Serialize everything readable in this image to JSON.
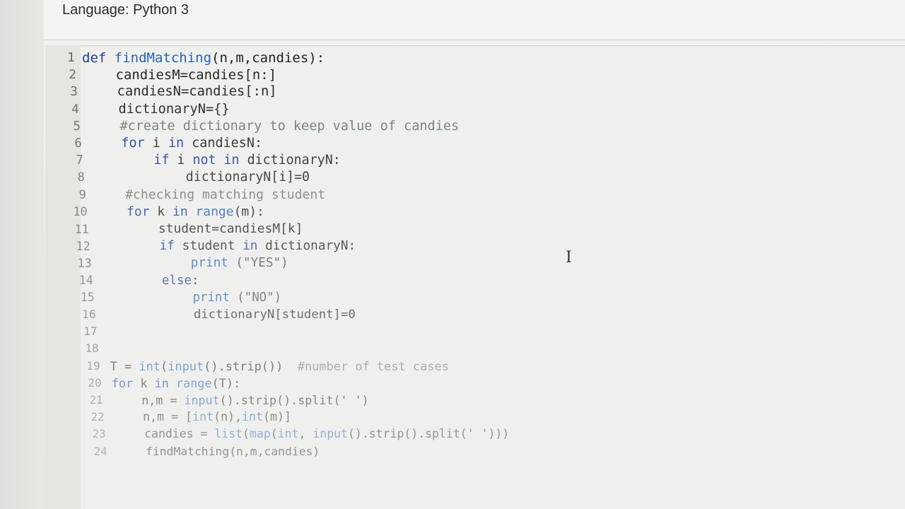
{
  "header": {
    "language_label": "Language: Python 3"
  },
  "editor": {
    "lines": [
      {
        "no": "1",
        "indent": "",
        "tokens": [
          [
            "kw",
            "def "
          ],
          [
            "fn",
            "findMatching"
          ],
          [
            "pl",
            "(n,m,candies):"
          ]
        ]
      },
      {
        "no": "2",
        "indent": "    ",
        "tokens": [
          [
            "pl",
            "candiesM=candies[n:]"
          ]
        ]
      },
      {
        "no": "3",
        "indent": "    ",
        "tokens": [
          [
            "pl",
            "candiesN=candies[:n]"
          ]
        ]
      },
      {
        "no": "4",
        "indent": "    ",
        "tokens": [
          [
            "pl",
            "dictionaryN={}"
          ]
        ]
      },
      {
        "no": "5",
        "indent": "    ",
        "tokens": [
          [
            "cm",
            "#create dictionary to keep value of candies"
          ]
        ]
      },
      {
        "no": "6",
        "indent": "    ",
        "tokens": [
          [
            "kw",
            "for "
          ],
          [
            "pl",
            "i "
          ],
          [
            "kw",
            "in "
          ],
          [
            "pl",
            "candiesN:"
          ]
        ]
      },
      {
        "no": "7",
        "indent": "        ",
        "tokens": [
          [
            "kw",
            "if "
          ],
          [
            "pl",
            "i "
          ],
          [
            "kw",
            "not in "
          ],
          [
            "pl",
            "dictionaryN:"
          ]
        ]
      },
      {
        "no": "8",
        "indent": "            ",
        "tokens": [
          [
            "pl",
            "dictionaryN[i]=0"
          ]
        ]
      },
      {
        "no": "9",
        "indent": "    ",
        "tokens": [
          [
            "cm",
            "#checking matching student"
          ]
        ]
      },
      {
        "no": "10",
        "indent": "    ",
        "tokens": [
          [
            "kw",
            "for "
          ],
          [
            "pl",
            "k "
          ],
          [
            "kw",
            "in "
          ],
          [
            "fn",
            "range"
          ],
          [
            "pl",
            "(m):"
          ]
        ]
      },
      {
        "no": "11",
        "indent": "        ",
        "tokens": [
          [
            "pl",
            "student=candiesM[k]"
          ]
        ]
      },
      {
        "no": "12",
        "indent": "        ",
        "tokens": [
          [
            "kw",
            "if "
          ],
          [
            "pl",
            "student "
          ],
          [
            "kw",
            "in "
          ],
          [
            "pl",
            "dictionaryN:"
          ]
        ]
      },
      {
        "no": "13",
        "indent": "            ",
        "tokens": [
          [
            "fn",
            "print "
          ],
          [
            "st",
            "(\"YES\")"
          ]
        ]
      },
      {
        "no": "14",
        "indent": "        ",
        "tokens": [
          [
            "kw",
            "else"
          ],
          [
            "pl",
            ":"
          ]
        ]
      },
      {
        "no": "15",
        "indent": "            ",
        "tokens": [
          [
            "fn",
            "print "
          ],
          [
            "st",
            "(\"NO\")"
          ]
        ]
      },
      {
        "no": "16",
        "indent": "            ",
        "tokens": [
          [
            "pl",
            "dictionaryN[student]=0"
          ]
        ]
      },
      {
        "no": "17",
        "indent": "",
        "tokens": []
      },
      {
        "no": "18",
        "indent": "",
        "tokens": []
      },
      {
        "no": "19",
        "indent": "",
        "tokens": [
          [
            "pl",
            "T = "
          ],
          [
            "fn",
            "int"
          ],
          [
            "pl",
            "("
          ],
          [
            "fn",
            "input"
          ],
          [
            "pl",
            "().strip())  "
          ],
          [
            "cm",
            "#number of test cases"
          ]
        ]
      },
      {
        "no": "20",
        "indent": "",
        "tokens": [
          [
            "kw",
            "for "
          ],
          [
            "pl",
            "k "
          ],
          [
            "kw",
            "in "
          ],
          [
            "fn",
            "range"
          ],
          [
            "pl",
            "(T):"
          ]
        ]
      },
      {
        "no": "21",
        "indent": "    ",
        "tokens": [
          [
            "pl",
            "n,m = "
          ],
          [
            "fn",
            "input"
          ],
          [
            "pl",
            "().strip().split(' ')"
          ]
        ]
      },
      {
        "no": "22",
        "indent": "    ",
        "tokens": [
          [
            "pl",
            "n,m = ["
          ],
          [
            "fn",
            "int"
          ],
          [
            "pl",
            "(n),"
          ],
          [
            "fn",
            "int"
          ],
          [
            "pl",
            "(m)]"
          ]
        ]
      },
      {
        "no": "23",
        "indent": "    ",
        "tokens": [
          [
            "pl",
            "candies = "
          ],
          [
            "fn",
            "list"
          ],
          [
            "pl",
            "("
          ],
          [
            "fn",
            "map"
          ],
          [
            "pl",
            "("
          ],
          [
            "fn",
            "int"
          ],
          [
            "pl",
            ", "
          ],
          [
            "fn",
            "input"
          ],
          [
            "pl",
            "().strip().split(' ')))"
          ]
        ]
      },
      {
        "no": "24",
        "indent": "    ",
        "tokens": [
          [
            "pl",
            "findMatching(n,m,candies)"
          ]
        ]
      }
    ]
  }
}
